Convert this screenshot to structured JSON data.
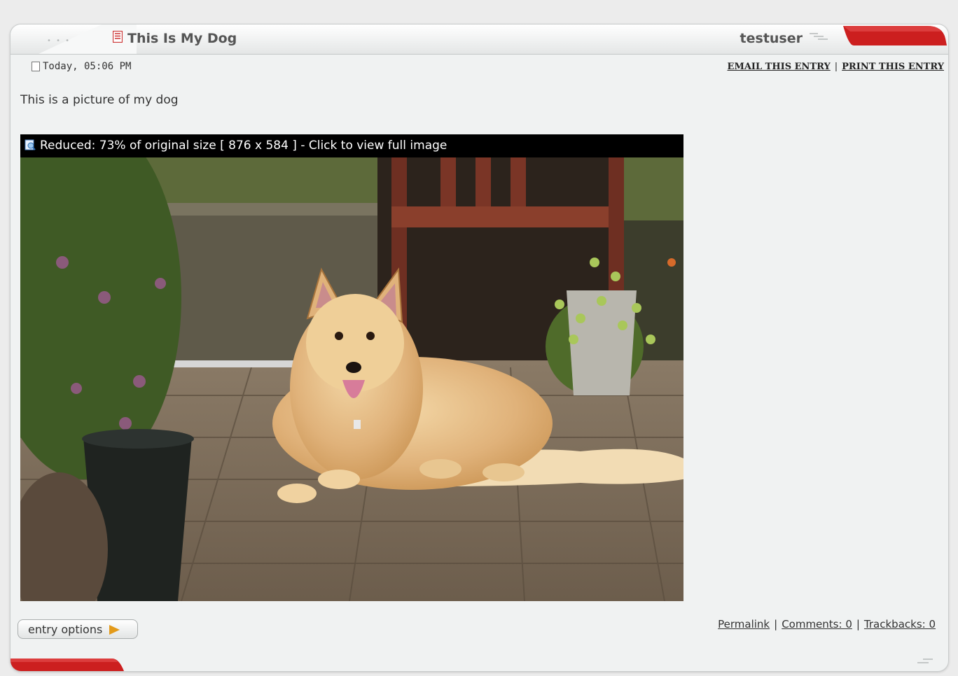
{
  "entry": {
    "title": "This Is My Dog",
    "username": "testuser",
    "date": "Today, 05:06 PM",
    "body": "This is a picture of my dog"
  },
  "actions": {
    "email": "EMAIL THIS ENTRY",
    "separator": "|",
    "print": "PRINT THIS ENTRY"
  },
  "image": {
    "caption": "Reduced: 73% of original size [ 876 x 584 ] - Click to view full image",
    "icon": "image-icon"
  },
  "footer": {
    "entry_options": "entry options",
    "permalink": "Permalink",
    "comments": "Comments: 0",
    "trackbacks": "Trackbacks: 0",
    "separator": "|"
  },
  "colors": {
    "accent_red": "#cc1f1f",
    "arrow_orange": "#e39a1a",
    "panel_bg": "#f0f2f2"
  }
}
